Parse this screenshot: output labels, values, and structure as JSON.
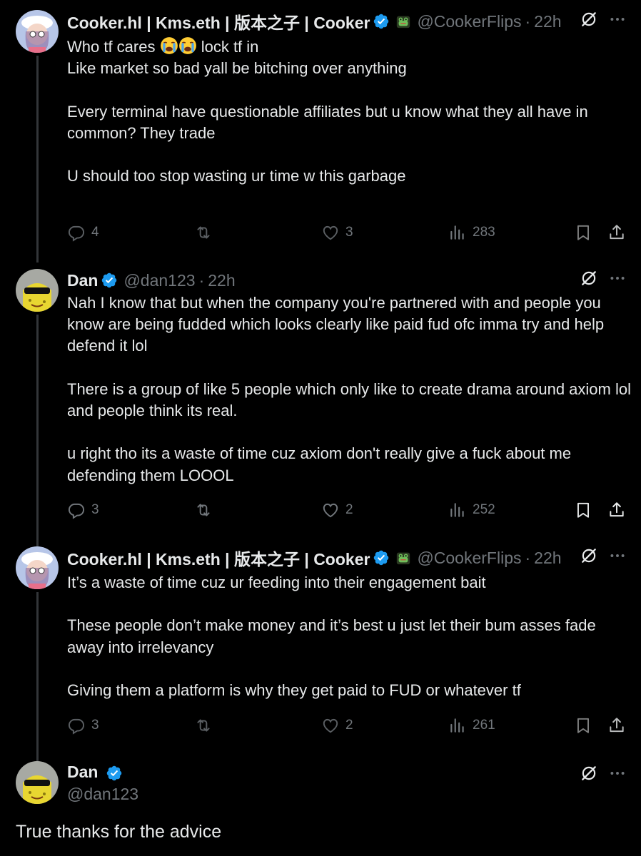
{
  "tweets": [
    {
      "name": "Cooker.hl | Kms.eth | 版本之子 | Cooker",
      "handle": "@CookerFlips",
      "dot": "·",
      "time": "22h",
      "text_before_emoji": "Who tf cares ",
      "text_after_emoji": " lock tf in",
      "body": "\nLike market so bad yall be bitching over anything\n\nEvery terminal have questionable affiliates but u know what they all have in common? They trade\n\nU should too stop wasting ur time w this garbage",
      "replies": "4",
      "reposts": "",
      "likes": "3",
      "views": "283"
    },
    {
      "name": "Dan",
      "handle": "@dan123",
      "dot": "·",
      "time": "22h",
      "body": "Nah I know that but when the company you're partnered with and people you know are being fudded which looks clearly like paid fud ofc imma try and help defend it lol\n\nThere is a group of like 5 people which only like to create drama around axiom lol and people think its real.\n\nu right tho its a waste of time cuz axiom don't really give a fuck about me defending them LOOOL",
      "replies": "3",
      "reposts": "",
      "likes": "2",
      "views": "252"
    },
    {
      "name": "Cooker.hl | Kms.eth | 版本之子 | Cooker",
      "handle": "@CookerFlips",
      "dot": "·",
      "time": "22h",
      "body": "It’s a waste of time cuz ur feeding into their engagement bait\n\nThese people don’t make money and it’s best u just let their bum asses fade away into irrelevancy\n\nGiving them a platform is why they get paid to FUD or whatever tf",
      "replies": "3",
      "reposts": "",
      "likes": "2",
      "views": "261"
    }
  ],
  "focused": {
    "name": "Dan",
    "handle": "@dan123",
    "body": "True thanks for the advice"
  },
  "colors": {
    "background": "#000000",
    "text": "#e7e9ea",
    "muted": "#71767b",
    "verified": "#1d9bf0",
    "thread_line": "#333639"
  },
  "icons": [
    "verified-badge-icon",
    "frog-emoji-icon",
    "grok-icon",
    "more-icon",
    "reply-icon",
    "repost-icon",
    "like-icon",
    "views-icon",
    "bookmark-icon",
    "share-icon",
    "crying-emoji-icon"
  ]
}
